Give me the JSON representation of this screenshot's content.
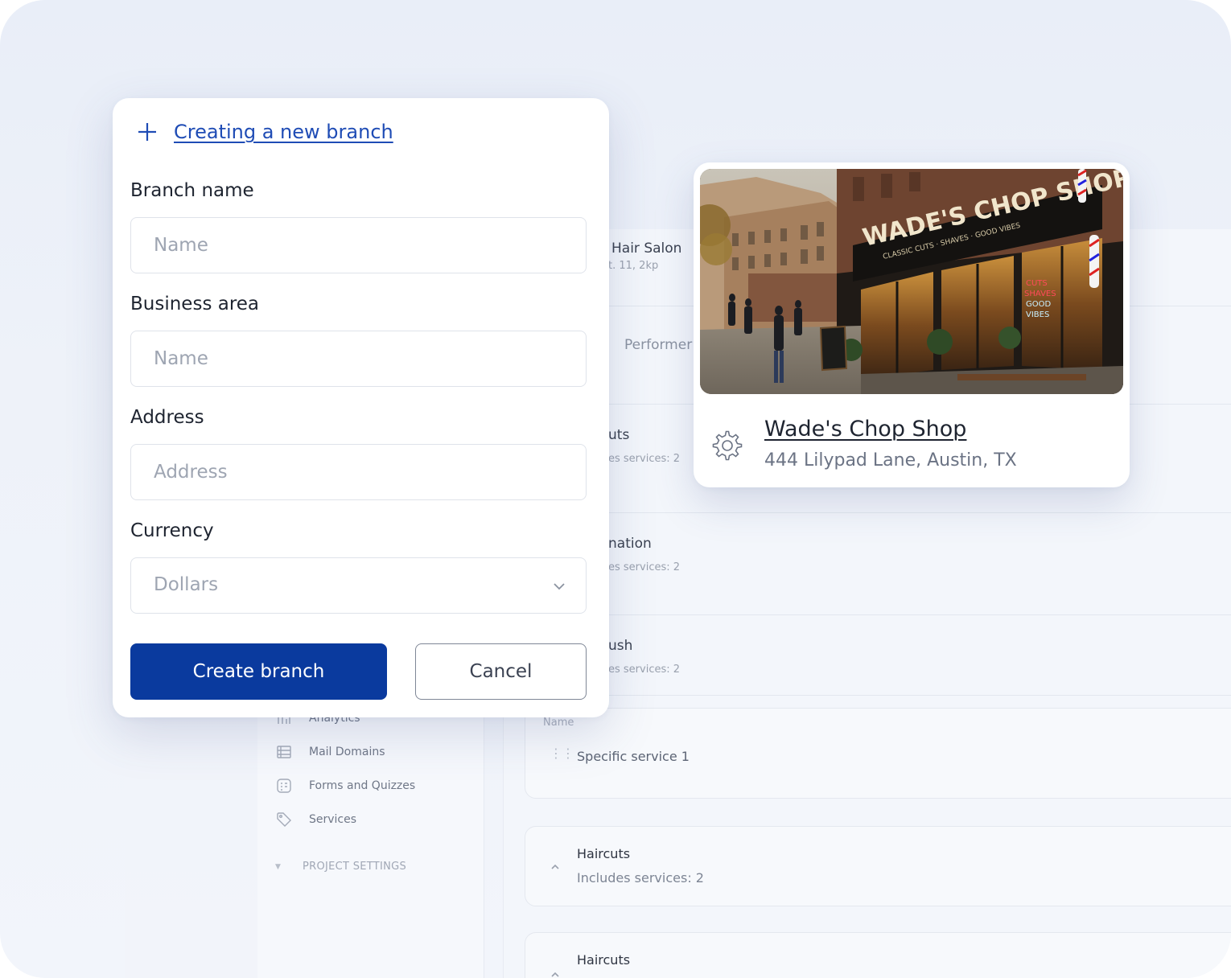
{
  "modal": {
    "title": "Creating a new branch",
    "fields": [
      {
        "label": "Branch name",
        "placeholder": "Name",
        "value": ""
      },
      {
        "label": "Business area",
        "placeholder": "Name",
        "value": ""
      },
      {
        "label": "Address",
        "placeholder": "Address",
        "value": ""
      }
    ],
    "currency": {
      "label": "Currency",
      "selected": "Dollars"
    },
    "create_label": "Create branch",
    "cancel_label": "Cancel"
  },
  "shop_card": {
    "name": "Wade's Chop Shop",
    "address": "444 Lilypad Lane, Austin, TX",
    "photo_sign": {
      "main": "WADE'S CHOP SHOP",
      "sub": "CLASSIC CUTS · SHAVES · GOOD VIBES",
      "neon": [
        "CUTS",
        "SHAVES",
        "GOOD",
        "VIBES"
      ]
    }
  },
  "background": {
    "rows": [
      {
        "title": "Hair Salon",
        "subtitle": "t. 11, 2kp"
      },
      {
        "title": "Performer",
        "subtitle": ""
      },
      {
        "title": "uts",
        "subtitle": "es services: 2"
      },
      {
        "title": "nation",
        "subtitle": "es services: 2"
      },
      {
        "title": "ush",
        "subtitle": "es services: 2"
      }
    ],
    "sidebar": {
      "items": [
        "Analytics",
        "Mail Domains",
        "Forms and Quizzes",
        "Services"
      ],
      "section": "PROJECT SETTINGS"
    },
    "service_cards": [
      {
        "label": "Name",
        "text": "Specific service 1"
      },
      {
        "title": "Haircuts",
        "subtitle": "Includes services: 2"
      },
      {
        "title": "Haircuts"
      }
    ]
  },
  "colors": {
    "primary": "#0a3a9e",
    "link": "#1f4cb5",
    "text": "#1e2430",
    "muted": "#9ea5b2"
  }
}
